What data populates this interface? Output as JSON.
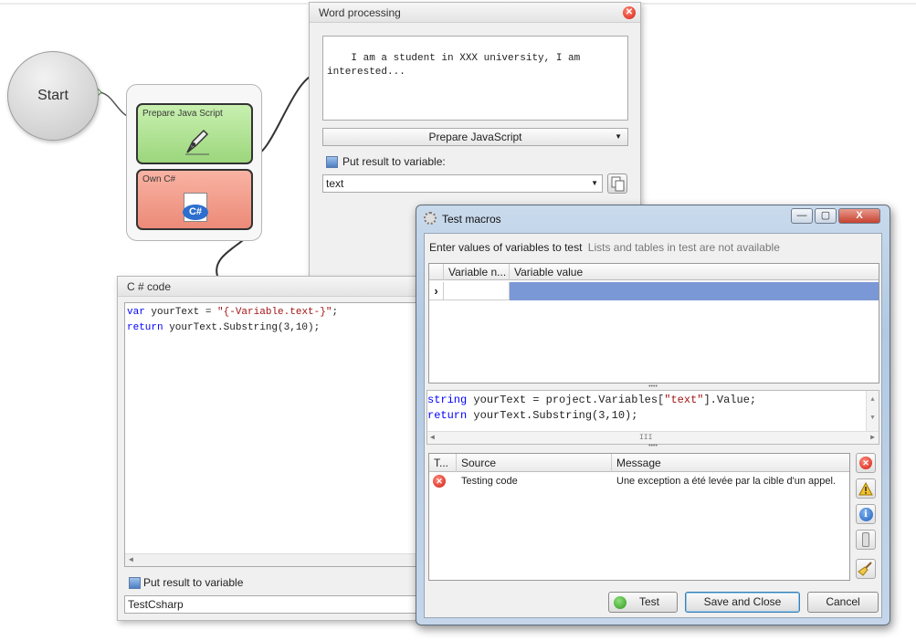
{
  "flow": {
    "start_label": "Start",
    "js_block_label": "Prepare Java Script",
    "cs_block_label": "Own C#",
    "cs_icon_text": "C#"
  },
  "word_panel": {
    "title": "Word processing",
    "text": "I am a student in XXX university, I am\ninterested...",
    "dropdown_label": "Prepare JavaScript",
    "put_result_label": "Put result to variable:",
    "variable_value": "text"
  },
  "csharp_panel": {
    "title": "C # code",
    "code_line1_kw": "var",
    "code_line1_rest": " yourText = ",
    "code_line1_str": "\"{-Variable.text-}\"",
    "code_line1_end": ";",
    "code_line2_kw": "return",
    "code_line2_rest": " yourText.Substring(3,10);",
    "put_result_label": "Put result to variable",
    "variable_value": "TestCsharp"
  },
  "test_window": {
    "title": "Test macros",
    "caption_min": "—",
    "caption_max": "▢",
    "caption_close": "X",
    "heading": "Enter values of variables to test",
    "heading_note": "Lists and tables in test are not available",
    "var_grid": {
      "col_name": "Variable n...",
      "col_value": "Variable value",
      "row_marker": "›"
    },
    "code_line1_kw": "string",
    "code_line1_mid": " yourText = project.Variables[",
    "code_line1_str": "\"text\"",
    "code_line1_end": "].Value;",
    "code_line2_kw": "return",
    "code_line2_rest": " yourText.Substring(3,10);",
    "scroll_thumb": "III",
    "log": {
      "col_type": "T...",
      "col_source": "Source",
      "col_message": "Message",
      "rows": [
        {
          "source": "Testing code",
          "message": "Une exception a été levée par la cible d'un appel."
        }
      ]
    },
    "buttons": {
      "test": "Test",
      "save_close": "Save and Close",
      "cancel": "Cancel"
    }
  },
  "colors": {
    "js_block": "#9cd67c",
    "cs_block": "#ec8a78",
    "selection": "#7b98d6",
    "error": "#d21b0e",
    "keyword": "#0000ff",
    "string": "#a31515"
  }
}
